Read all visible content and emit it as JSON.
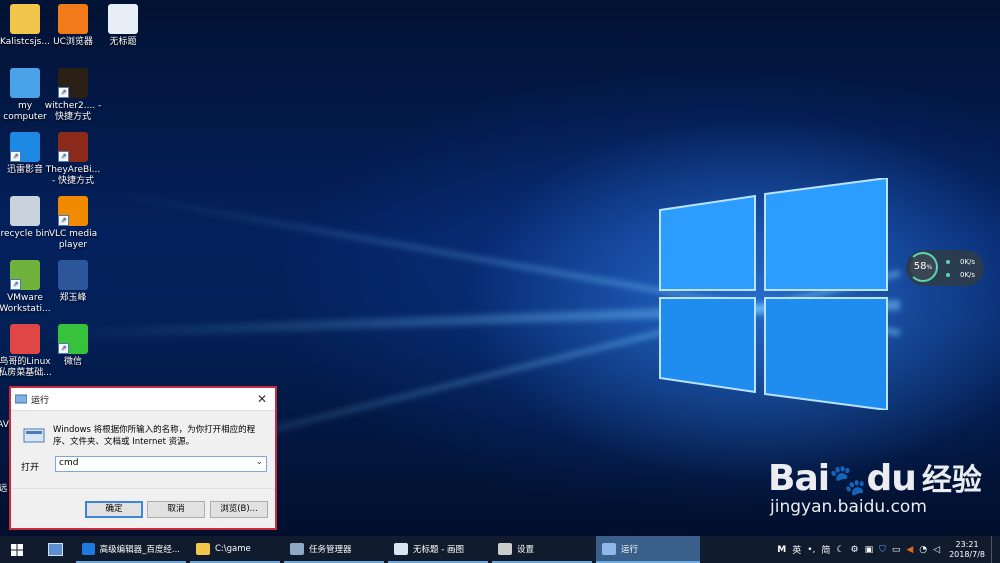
{
  "desktop_icons": [
    {
      "label": "Kalistcsjs...",
      "icon": "folder-icon",
      "color": "#f2c54b",
      "shortcut": false
    },
    {
      "label": "UC浏览器",
      "icon": "uc-browser-icon",
      "color": "#f27a1a",
      "shortcut": false
    },
    {
      "label": "无标题",
      "icon": "image-file-icon",
      "color": "#e8eef6",
      "shortcut": false
    },
    {
      "label": "my computer",
      "icon": "computer-icon",
      "color": "#4aa3e8",
      "shortcut": false
    },
    {
      "label": "witcher2.... - 快捷方式",
      "icon": "witcher-icon",
      "color": "#2a2016",
      "shortcut": true
    },
    {
      "label": "迅雷影音",
      "icon": "xunlei-icon",
      "color": "#1e88e5",
      "shortcut": true
    },
    {
      "label": "TheyAreBi... - 快捷方式",
      "icon": "game-icon",
      "color": "#8b2a1a",
      "shortcut": true
    },
    {
      "label": "recycle bin",
      "icon": "recycle-bin-icon",
      "color": "#c9d3de",
      "shortcut": false
    },
    {
      "label": "VLC media player",
      "icon": "vlc-icon",
      "color": "#f08a00",
      "shortcut": true
    },
    {
      "label": "VMware Workstati...",
      "icon": "vmware-icon",
      "color": "#6fb23c",
      "shortcut": true
    },
    {
      "label": "郑玉峰",
      "icon": "word-doc-icon",
      "color": "#2b579a",
      "shortcut": false
    },
    {
      "label": "鸟哥的Linux 私房菜基础...",
      "icon": "pdf-icon",
      "color": "#e04646",
      "shortcut": false
    },
    {
      "label": "微信",
      "icon": "wechat-icon",
      "color": "#37c23e",
      "shortcut": true
    }
  ],
  "edge_labels": [
    "AV",
    "远"
  ],
  "net_widget": {
    "percent": "58",
    "unit": "%",
    "up": "0K/s",
    "down": "0K/s"
  },
  "run_dialog": {
    "title": "运行",
    "description": "Windows 将根据你所输入的名称，为你打开相应的程序、文件夹、文档或 Internet 资源。",
    "open_label": "打开",
    "input_value": "cmd",
    "buttons": {
      "ok": "确定",
      "cancel": "取消",
      "browse": "浏览(B)..."
    }
  },
  "taskbar": {
    "items": [
      {
        "label": "高级编辑器_百度经...",
        "icon": "browser-icon",
        "color": "#1f7ae0"
      },
      {
        "label": "C:\\game",
        "icon": "folder-icon",
        "color": "#f2c54b"
      },
      {
        "label": "任务管理器",
        "icon": "task-manager-icon",
        "color": "#8fa9c4"
      },
      {
        "label": "无标题 - 画图",
        "icon": "paint-icon",
        "color": "#d9e6f2"
      },
      {
        "label": "设置",
        "icon": "gear-icon",
        "color": "#cccccc"
      },
      {
        "label": "运行",
        "icon": "run-icon",
        "color": "#8fb8e8"
      }
    ],
    "ime": "英",
    "ime_mode": "简",
    "time": "23:21",
    "date": "2018/7/8"
  },
  "watermark": {
    "brand": "Bai",
    "brand2": "du",
    "cn": "经验",
    "url": "jingyan.baidu.com"
  }
}
